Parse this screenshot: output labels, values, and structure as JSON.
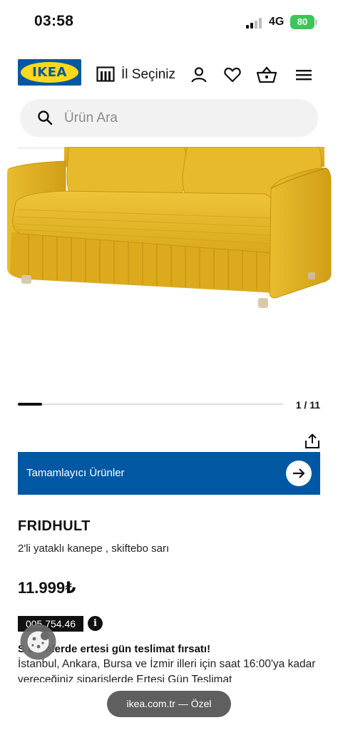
{
  "status_bar": {
    "time": "03:58",
    "network": "4G",
    "battery": "80"
  },
  "header": {
    "logo_text": "IKEA",
    "store_label": "İl Seçiniz",
    "icons": [
      "store-icon",
      "user-icon",
      "heart-icon",
      "basket-icon",
      "menu-icon"
    ]
  },
  "search": {
    "placeholder": "Ürün Ara"
  },
  "gallery": {
    "pager": "1 / 11",
    "progress_fraction": 0.0909
  },
  "banner": {
    "label": "Tamamlayıcı Ürünler"
  },
  "product": {
    "name": "FRIDHULT",
    "description": "2'li yataklı kanepe , skiftebo sarı",
    "price": "11.999₺",
    "article_number": "005.754.46",
    "info_icon": "i",
    "delivery_title": "S    ürünlerde ertesi gün teslimat fırsatı!",
    "delivery_text": "İstanbul, Ankara, Bursa ve İzmir illeri için saat 16:00'ya kadar vereceğiniz siparişlerde Ertesi Gün Teslimat"
  },
  "browser": {
    "url_label": "ikea.com.tr — Özel"
  },
  "colors": {
    "ikea_blue": "#0058a3",
    "ikea_yellow": "#ffda1a",
    "sofa_yellow": "#e2b321",
    "battery_green": "#3cc55a"
  }
}
